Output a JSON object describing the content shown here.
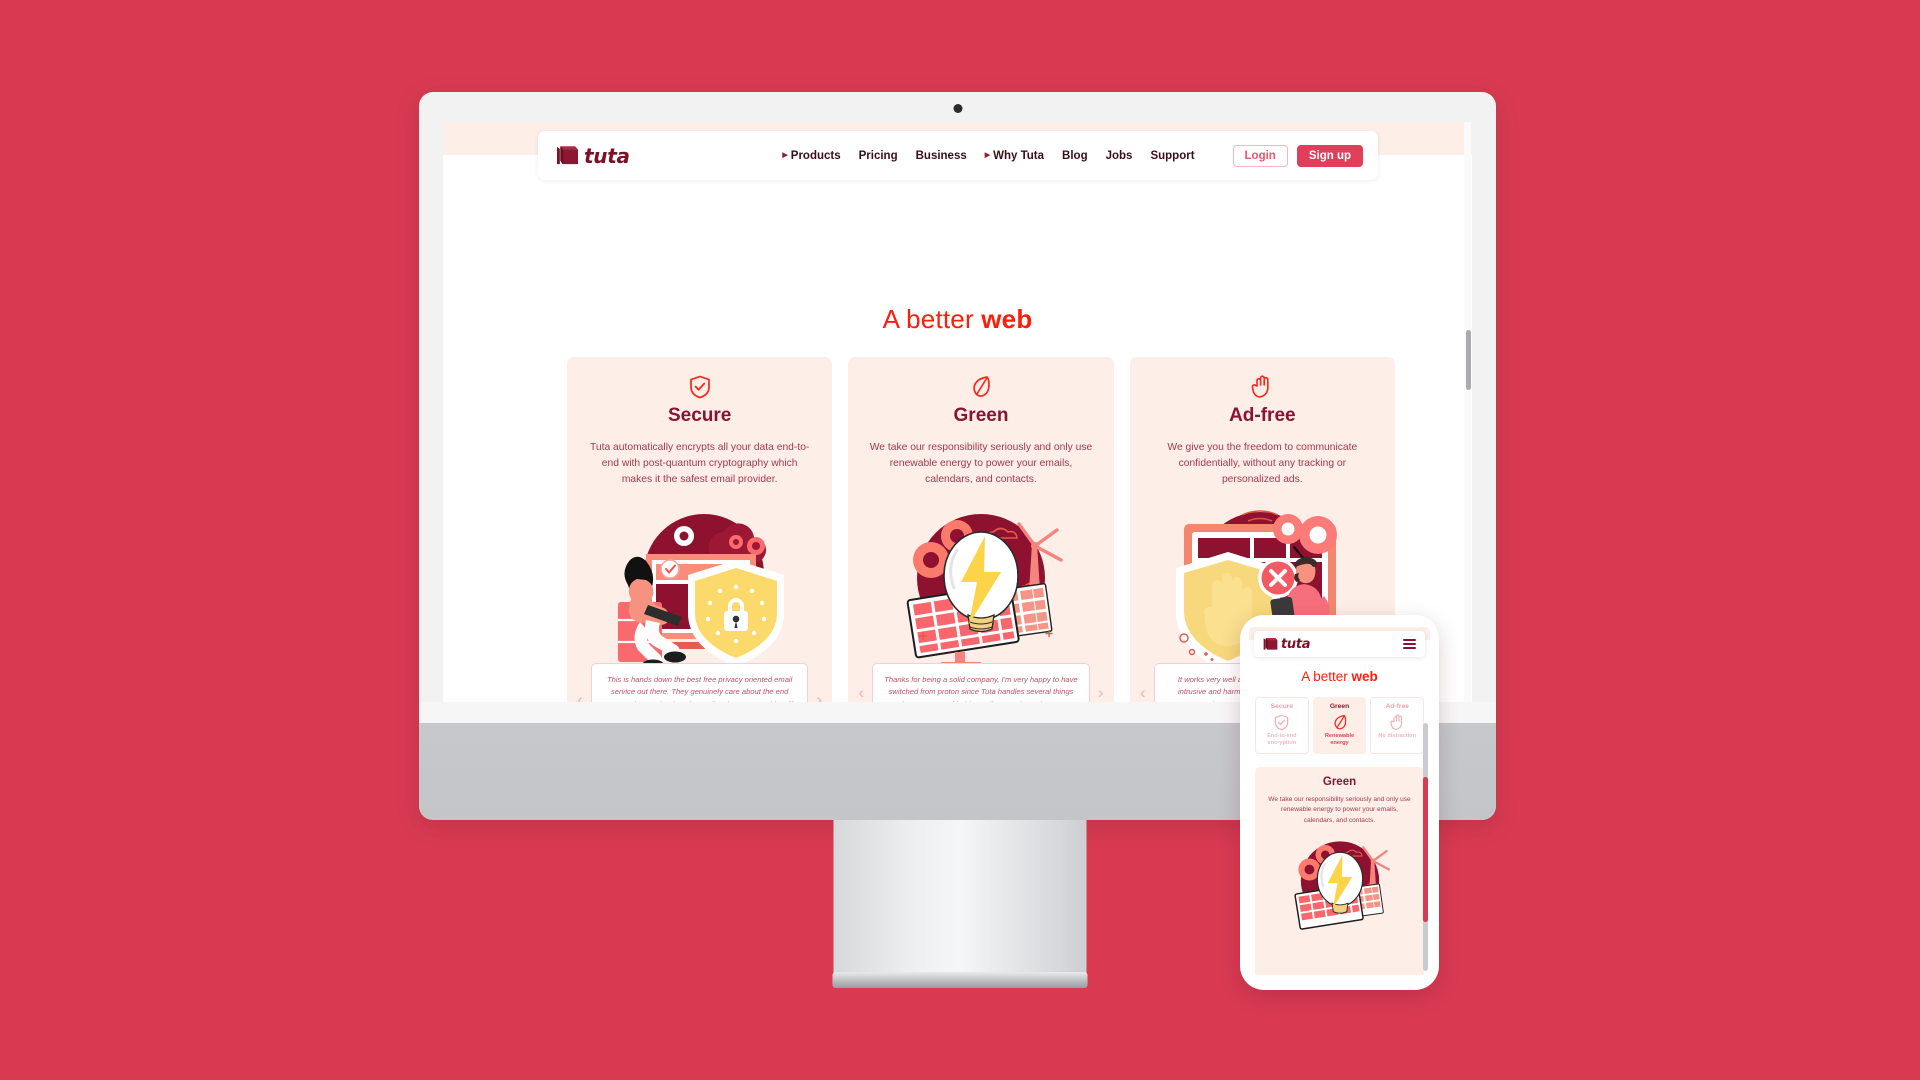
{
  "background_color": "#d93a52",
  "brand": {
    "name": "tuta",
    "logo_icon": "tuta-box-logo",
    "wordmark_color": "#7d1128"
  },
  "colors": {
    "accent_red": "#fb1f0b",
    "brand_pink": "#e03e5a",
    "card_bg": "#fdeee7",
    "title_maroon": "#8a1332",
    "body_text": "#a23a4e"
  },
  "desktop": {
    "nav": {
      "links": [
        {
          "label": "Products",
          "has_caret": true
        },
        {
          "label": "Pricing",
          "has_caret": false
        },
        {
          "label": "Business",
          "has_caret": false
        },
        {
          "label": "Why Tuta",
          "has_caret": true
        },
        {
          "label": "Blog",
          "has_caret": false
        },
        {
          "label": "Jobs",
          "has_caret": false
        },
        {
          "label": "Support",
          "has_caret": false
        }
      ],
      "login_label": "Login",
      "signup_label": "Sign up"
    },
    "hero": {
      "heading_prefix": "A better ",
      "heading_strong": "web"
    },
    "cards": [
      {
        "icon": "shield-check-icon",
        "title": "Secure",
        "description": "Tuta automatically encrypts all your data end-to-end with post-quantum cryptography which makes it the safest email provider.",
        "illustration": "woman-laptop-shield-lock-illustration",
        "testimonial": "This is hands down the best free privacy oriented email service out there. They genuinely care about the end users privacy. The data they collect is next to nothing (if any) and provide a plethora of amazing services.",
        "prev_arrow": "‹",
        "next_arrow": "›"
      },
      {
        "icon": "leaf-icon",
        "title": "Green",
        "description": "We take our responsibility seriously and only use renewable energy to power your emails, calendars, and contacts.",
        "illustration": "lightbulb-solar-windmill-illustration",
        "testimonial": "Thanks for being a solid company, I'm very happy to have switched from proton since Tuta handles several things (green energy, fdroid app, linux app) way better.",
        "prev_arrow": "‹",
        "next_arrow": "›"
      },
      {
        "icon": "raised-hand-icon",
        "title": "Ad-free",
        "description": "We give you the freedom to communicate confidentially, without any tracking or personalized ads.",
        "illustration": "monitor-shield-hand-blocked-ads-illustration",
        "testimonial": "It works very well and you are not bombarded with intrusive and harmful advertising. A most excellent replacement for all Microsof account",
        "prev_arrow": "‹",
        "next_arrow": "›"
      }
    ]
  },
  "mobile": {
    "nav": {
      "menu_icon": "hamburger-menu-icon"
    },
    "hero": {
      "heading_prefix": "A better ",
      "heading_strong": "web"
    },
    "tabs": [
      {
        "title": "Secure",
        "subtitle": "End-to-end encryption",
        "icon": "shield-check-icon",
        "active": false
      },
      {
        "title": "Green",
        "subtitle": "Renewable energy",
        "icon": "leaf-icon",
        "active": true
      },
      {
        "title": "Ad-free",
        "subtitle": "No distraction",
        "icon": "raised-hand-icon",
        "active": false
      }
    ],
    "panel": {
      "title": "Green",
      "description": "We take our responsibility seriously and only use renewable energy to power your emails, calendars, and contacts.",
      "illustration": "lightbulb-solar-windmill-illustration"
    }
  }
}
